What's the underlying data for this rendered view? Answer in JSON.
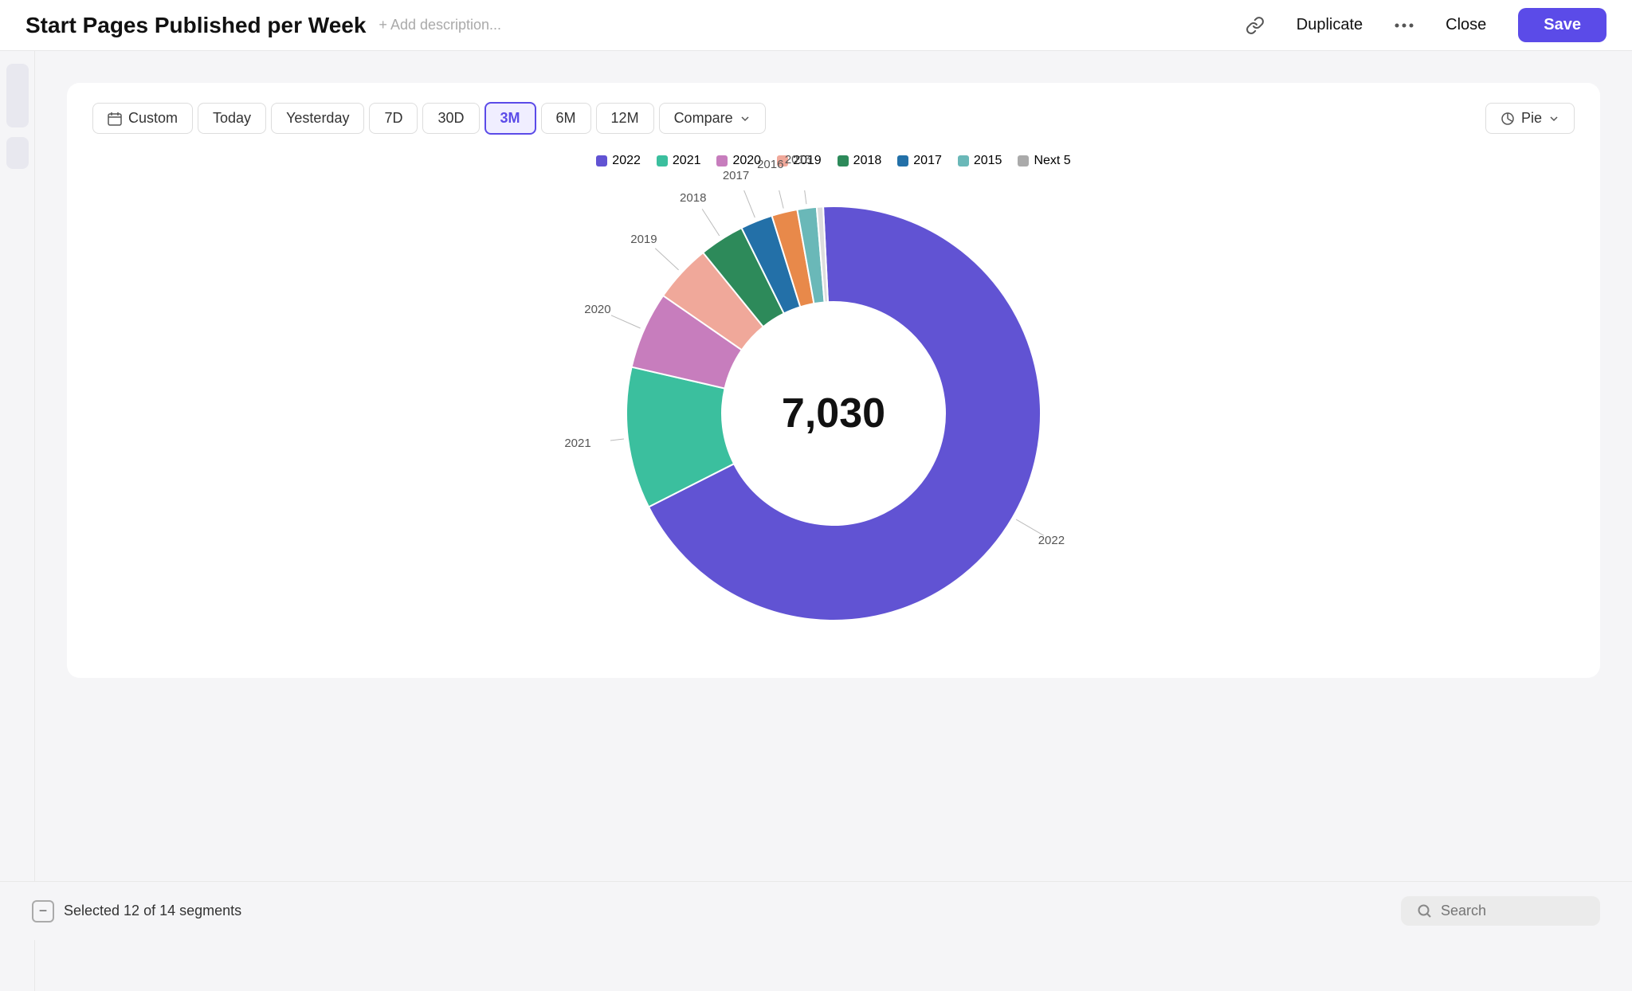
{
  "header": {
    "title": "Start Pages Published per Week",
    "add_description": "+ Add description...",
    "duplicate_label": "Duplicate",
    "close_label": "Close",
    "save_label": "Save"
  },
  "filters": {
    "custom_label": "Custom",
    "today_label": "Today",
    "yesterday_label": "Yesterday",
    "7d_label": "7D",
    "30d_label": "30D",
    "3m_label": "3M",
    "6m_label": "6M",
    "12m_label": "12M",
    "compare_label": "Compare",
    "pie_label": "Pie",
    "active": "3M"
  },
  "legend": [
    {
      "year": "2022",
      "color": "#6153d3"
    },
    {
      "year": "2021",
      "color": "#3bbf9e"
    },
    {
      "year": "2020",
      "color": "#c77dbd"
    },
    {
      "year": "2019",
      "color": "#f0a89a"
    },
    {
      "year": "2018",
      "color": "#2d8a5a"
    },
    {
      "year": "2017",
      "color": "#2370a8"
    },
    {
      "year": "2015",
      "color": "#6ab8b8"
    },
    {
      "year": "Next 5",
      "color": "#aaa"
    }
  ],
  "chart": {
    "total": "7,030",
    "segments": [
      {
        "year": "2022",
        "color": "#6153d3",
        "percent": 68
      },
      {
        "year": "2021",
        "color": "#3bbf9e",
        "percent": 11
      },
      {
        "year": "2020",
        "color": "#c77dbd",
        "percent": 6
      },
      {
        "year": "2019",
        "color": "#f0a89a",
        "percent": 4.5
      },
      {
        "year": "2018",
        "color": "#2d8a5a",
        "percent": 3.5
      },
      {
        "year": "2017",
        "color": "#2370a8",
        "percent": 2.5
      },
      {
        "year": "2016",
        "color": "#e8894a",
        "percent": 2
      },
      {
        "year": "2015",
        "color": "#6ab8b8",
        "percent": 1.5
      },
      {
        "year": "other",
        "color": "#ddd",
        "percent": 0.5
      }
    ]
  },
  "bottom": {
    "selected_label": "Selected 12 of 14 segments",
    "search_placeholder": "Search"
  }
}
